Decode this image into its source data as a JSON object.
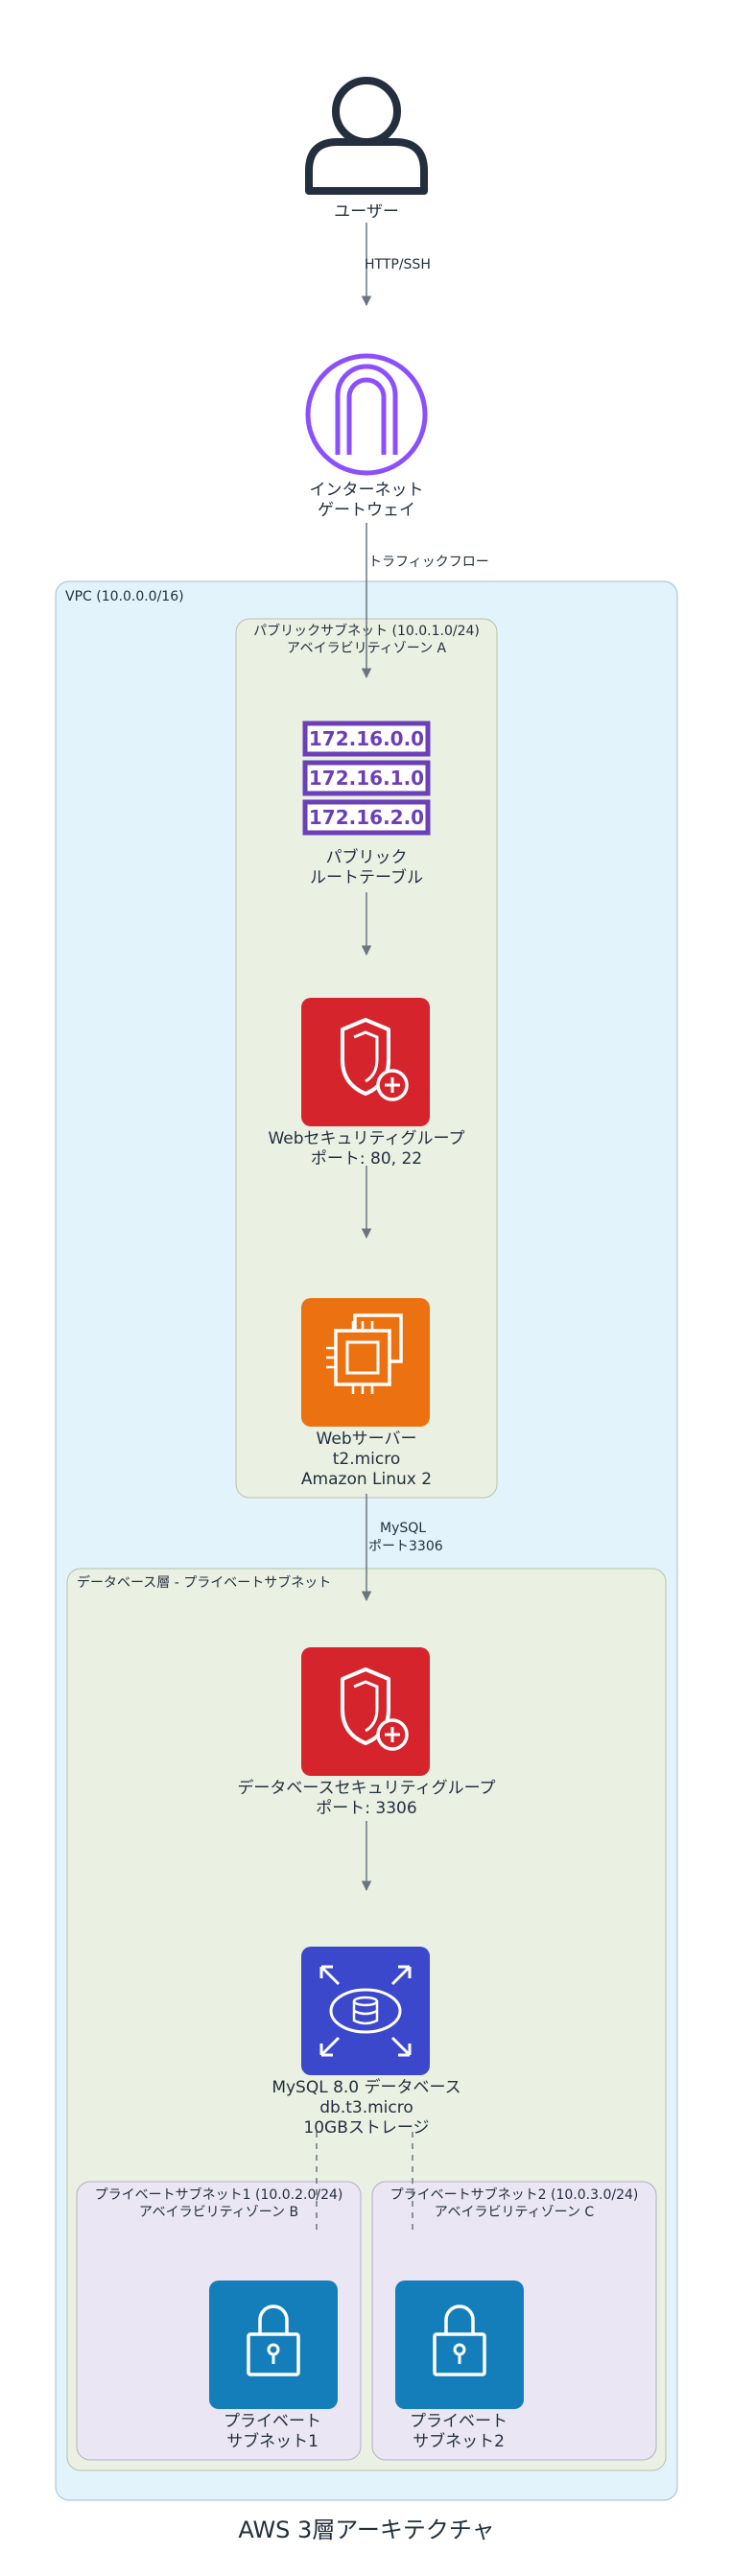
{
  "title": "AWS 3層アーキテクチャ",
  "colors": {
    "vpc_fill": "#e3f3fb",
    "vpc_stroke": "#9fbfd3",
    "subnet_fill": "#eaf1e3",
    "subnet_stroke": "#b6c3a8",
    "private_fill": "#ebe6f4",
    "private_stroke": "#b3adc4",
    "arrow": "#6b7580",
    "igw": "#8c4fff",
    "route": "#6b3fb8",
    "security": "#d6242d",
    "ec2": "#ec7211",
    "rds": "#3b48cc",
    "private_subnet_icon": "#147eba"
  },
  "nodes": {
    "user": {
      "icon": "user-icon",
      "line1": "ユーザー"
    },
    "igw": {
      "icon": "internet-gateway-icon",
      "line1": "インターネット",
      "line2": "ゲートウェイ"
    },
    "route_table": {
      "icon": "route-table-icon",
      "routes": [
        "172.16.0.0",
        "172.16.1.0",
        "172.16.2.0"
      ],
      "line1": "パブリック",
      "line2": "ルートテーブル"
    },
    "web_sg": {
      "icon": "shield-icon",
      "line1": "Webセキュリティグループ",
      "line2": "ポート: 80, 22"
    },
    "web_server": {
      "icon": "ec2-chip-icon",
      "line1": "Webサーバー",
      "line2": "t2.micro",
      "line3": "Amazon Linux 2"
    },
    "db_sg": {
      "icon": "shield-icon",
      "line1": "データベースセキュリティグループ",
      "line2": "ポート: 3306"
    },
    "rds": {
      "icon": "rds-database-icon",
      "line1": "MySQL 8.0 データベース",
      "line2": "db.t3.micro",
      "line3": "10GBストレージ"
    },
    "private1": {
      "icon": "lock-icon",
      "line1": "プライベート",
      "line2": "サブネット1"
    },
    "private2": {
      "icon": "lock-icon",
      "line1": "プライベート",
      "line2": "サブネット2"
    }
  },
  "groups": {
    "vpc": {
      "label": "VPC (10.0.0.0/16)"
    },
    "public_subnet": {
      "line1": "パブリックサブネット (10.0.1.0/24)",
      "line2": "アベイラビリティゾーン A"
    },
    "db_tier": {
      "label": "データベース層 - プライベートサブネット"
    },
    "private_subnet_1": {
      "line1": "プライベートサブネット1 (10.0.2.0/24)",
      "line2": "アベイラビリティゾーン B"
    },
    "private_subnet_2": {
      "line1": "プライベートサブネット2 (10.0.3.0/24)",
      "line2": "アベイラビリティゾーン C"
    }
  },
  "edges": {
    "user_igw": "HTTP/SSH",
    "igw_route": "トラフィックフロー",
    "web_db_line1": "MySQL",
    "web_db_line2": "ポート3306"
  }
}
